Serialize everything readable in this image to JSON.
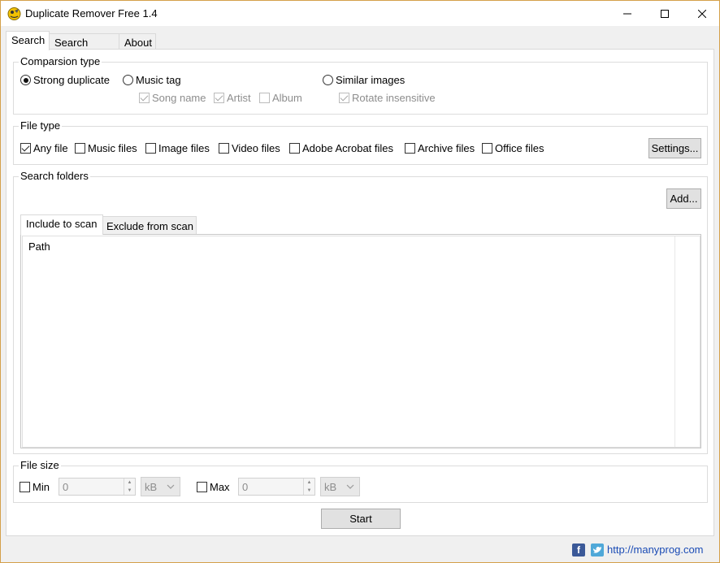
{
  "window": {
    "title": "Duplicate Remover Free 1.4"
  },
  "tabs": [
    {
      "label": "Search"
    },
    {
      "label": "Search result"
    },
    {
      "label": "About"
    }
  ],
  "comparison": {
    "legend": "Comparsion type",
    "strong": "Strong duplicate",
    "music": "Music tag",
    "similar": "Similar images",
    "song_name": "Song name",
    "artist": "Artist",
    "album": "Album",
    "rotate": "Rotate insensitive"
  },
  "file_type": {
    "legend": "File type",
    "any": "Any file",
    "music": "Music files",
    "image": "Image files",
    "video": "Video files",
    "acrobat": "Adobe Acrobat files",
    "archive": "Archive files",
    "office": "Office files",
    "settings_button": "Settings..."
  },
  "folders": {
    "legend": "Search folders",
    "add_button": "Add...",
    "include_tab": "Include to scan",
    "exclude_tab": "Exclude from scan",
    "path_header": "Path"
  },
  "file_size": {
    "legend": "File size",
    "min_label": "Min",
    "min_value": "0",
    "min_unit": "kB",
    "max_label": "Max",
    "max_value": "0",
    "max_unit": "kB"
  },
  "start_button": "Start",
  "footer": {
    "link": "http://manyprog.com"
  },
  "colors": {
    "window_border": "#d4a04a",
    "link": "#1a4bb5"
  }
}
